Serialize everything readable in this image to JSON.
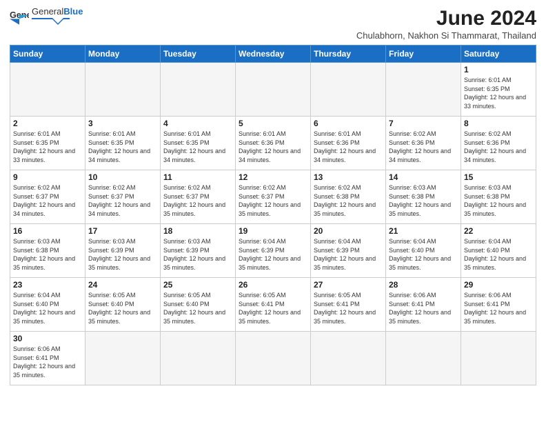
{
  "logo": {
    "text_general": "General",
    "text_blue": "Blue"
  },
  "header": {
    "title": "June 2024",
    "subtitle": "Chulabhorn, Nakhon Si Thammarat, Thailand"
  },
  "weekdays": [
    "Sunday",
    "Monday",
    "Tuesday",
    "Wednesday",
    "Thursday",
    "Friday",
    "Saturday"
  ],
  "days": {
    "d1": {
      "n": "1",
      "sr": "6:01 AM",
      "ss": "6:35 PM",
      "dl": "12 hours and 33 minutes."
    },
    "d2": {
      "n": "2",
      "sr": "6:01 AM",
      "ss": "6:35 PM",
      "dl": "12 hours and 33 minutes."
    },
    "d3": {
      "n": "3",
      "sr": "6:01 AM",
      "ss": "6:35 PM",
      "dl": "12 hours and 34 minutes."
    },
    "d4": {
      "n": "4",
      "sr": "6:01 AM",
      "ss": "6:35 PM",
      "dl": "12 hours and 34 minutes."
    },
    "d5": {
      "n": "5",
      "sr": "6:01 AM",
      "ss": "6:36 PM",
      "dl": "12 hours and 34 minutes."
    },
    "d6": {
      "n": "6",
      "sr": "6:01 AM",
      "ss": "6:36 PM",
      "dl": "12 hours and 34 minutes."
    },
    "d7": {
      "n": "7",
      "sr": "6:02 AM",
      "ss": "6:36 PM",
      "dl": "12 hours and 34 minutes."
    },
    "d8": {
      "n": "8",
      "sr": "6:02 AM",
      "ss": "6:36 PM",
      "dl": "12 hours and 34 minutes."
    },
    "d9": {
      "n": "9",
      "sr": "6:02 AM",
      "ss": "6:37 PM",
      "dl": "12 hours and 34 minutes."
    },
    "d10": {
      "n": "10",
      "sr": "6:02 AM",
      "ss": "6:37 PM",
      "dl": "12 hours and 34 minutes."
    },
    "d11": {
      "n": "11",
      "sr": "6:02 AM",
      "ss": "6:37 PM",
      "dl": "12 hours and 35 minutes."
    },
    "d12": {
      "n": "12",
      "sr": "6:02 AM",
      "ss": "6:37 PM",
      "dl": "12 hours and 35 minutes."
    },
    "d13": {
      "n": "13",
      "sr": "6:02 AM",
      "ss": "6:38 PM",
      "dl": "12 hours and 35 minutes."
    },
    "d14": {
      "n": "14",
      "sr": "6:03 AM",
      "ss": "6:38 PM",
      "dl": "12 hours and 35 minutes."
    },
    "d15": {
      "n": "15",
      "sr": "6:03 AM",
      "ss": "6:38 PM",
      "dl": "12 hours and 35 minutes."
    },
    "d16": {
      "n": "16",
      "sr": "6:03 AM",
      "ss": "6:38 PM",
      "dl": "12 hours and 35 minutes."
    },
    "d17": {
      "n": "17",
      "sr": "6:03 AM",
      "ss": "6:39 PM",
      "dl": "12 hours and 35 minutes."
    },
    "d18": {
      "n": "18",
      "sr": "6:03 AM",
      "ss": "6:39 PM",
      "dl": "12 hours and 35 minutes."
    },
    "d19": {
      "n": "19",
      "sr": "6:04 AM",
      "ss": "6:39 PM",
      "dl": "12 hours and 35 minutes."
    },
    "d20": {
      "n": "20",
      "sr": "6:04 AM",
      "ss": "6:39 PM",
      "dl": "12 hours and 35 minutes."
    },
    "d21": {
      "n": "21",
      "sr": "6:04 AM",
      "ss": "6:40 PM",
      "dl": "12 hours and 35 minutes."
    },
    "d22": {
      "n": "22",
      "sr": "6:04 AM",
      "ss": "6:40 PM",
      "dl": "12 hours and 35 minutes."
    },
    "d23": {
      "n": "23",
      "sr": "6:04 AM",
      "ss": "6:40 PM",
      "dl": "12 hours and 35 minutes."
    },
    "d24": {
      "n": "24",
      "sr": "6:05 AM",
      "ss": "6:40 PM",
      "dl": "12 hours and 35 minutes."
    },
    "d25": {
      "n": "25",
      "sr": "6:05 AM",
      "ss": "6:40 PM",
      "dl": "12 hours and 35 minutes."
    },
    "d26": {
      "n": "26",
      "sr": "6:05 AM",
      "ss": "6:41 PM",
      "dl": "12 hours and 35 minutes."
    },
    "d27": {
      "n": "27",
      "sr": "6:05 AM",
      "ss": "6:41 PM",
      "dl": "12 hours and 35 minutes."
    },
    "d28": {
      "n": "28",
      "sr": "6:06 AM",
      "ss": "6:41 PM",
      "dl": "12 hours and 35 minutes."
    },
    "d29": {
      "n": "29",
      "sr": "6:06 AM",
      "ss": "6:41 PM",
      "dl": "12 hours and 35 minutes."
    },
    "d30": {
      "n": "30",
      "sr": "6:06 AM",
      "ss": "6:41 PM",
      "dl": "12 hours and 35 minutes."
    }
  },
  "labels": {
    "sunrise": "Sunrise:",
    "sunset": "Sunset:",
    "daylight": "Daylight:"
  }
}
